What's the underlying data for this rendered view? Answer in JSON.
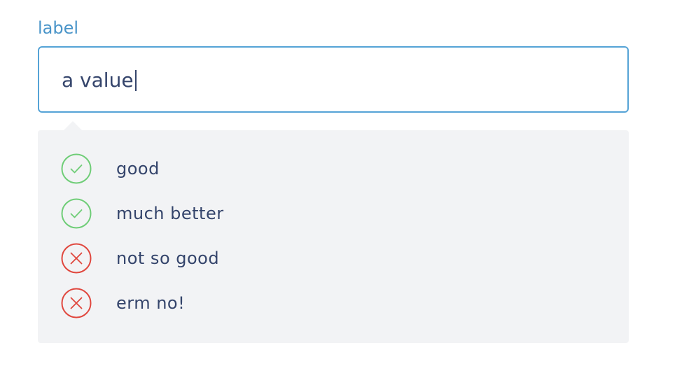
{
  "field": {
    "label": "label",
    "value": "a value"
  },
  "rules": [
    {
      "text": "good",
      "status": "pass",
      "icon": "check-circle-icon"
    },
    {
      "text": "much better",
      "status": "pass",
      "icon": "check-circle-icon"
    },
    {
      "text": "not so good",
      "status": "fail",
      "icon": "cross-circle-icon"
    },
    {
      "text": "erm no!",
      "status": "fail",
      "icon": "cross-circle-icon"
    }
  ],
  "colors": {
    "label": "#4a95c9",
    "input_border": "#55a3d6",
    "text": "#34446b",
    "panel_bg": "#f2f3f5",
    "pass": "#6fcd77",
    "fail": "#e0473e"
  }
}
